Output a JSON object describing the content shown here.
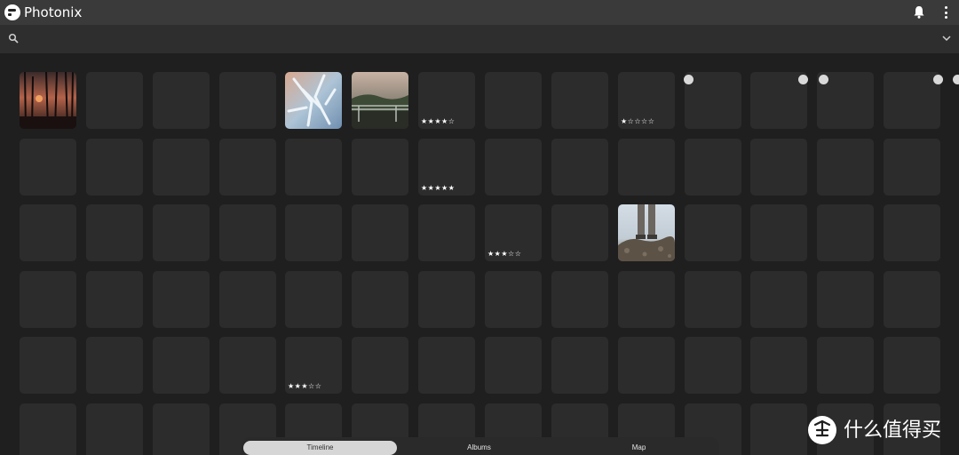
{
  "app": {
    "title": "Photonix"
  },
  "search": {
    "value": "",
    "placeholder": ""
  },
  "tabs": [
    {
      "label": "Timeline",
      "active": true
    },
    {
      "label": "Albums",
      "active": false
    },
    {
      "label": "Map",
      "active": false
    }
  ],
  "grid": {
    "rows": 6,
    "cols": 14,
    "photos": [
      {
        "row": 0,
        "col": 0,
        "image": "sunset-forest"
      },
      {
        "row": 0,
        "col": 4,
        "image": "frosted-branches"
      },
      {
        "row": 0,
        "col": 5,
        "image": "misty-lake-railing"
      },
      {
        "row": 2,
        "col": 9,
        "image": "feet-on-rocks"
      }
    ],
    "ratings": [
      {
        "row": 0,
        "col": 6,
        "text": "★★★★☆"
      },
      {
        "row": 0,
        "col": 9,
        "text": "★☆☆☆☆"
      },
      {
        "row": 1,
        "col": 6,
        "text": "★★★★★"
      },
      {
        "row": 2,
        "col": 7,
        "text": "★★★☆☆"
      },
      {
        "row": 4,
        "col": 4,
        "text": "★★★☆☆"
      }
    ]
  },
  "colors": {
    "topbar": "#3a3a3a",
    "searchbar": "#2e2e2e",
    "background": "#1f1f1f",
    "tile": "#2c2c2c",
    "tab_active": "#d6d6d6"
  },
  "watermark": {
    "text": "什么值得买",
    "logo": "值"
  }
}
